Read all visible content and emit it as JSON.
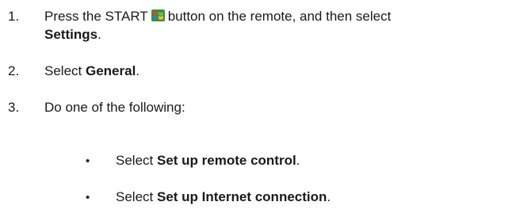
{
  "steps": [
    {
      "number": "1.",
      "text_before_icon": "Press the START",
      "icon": "windows-start-icon",
      "text_after_icon": "button on the remote, and then select",
      "bold_term": "Settings",
      "trailing": "."
    },
    {
      "number": "2.",
      "text_before": "Select",
      "bold_term": "General",
      "trailing": "."
    },
    {
      "number": "3.",
      "text": "Do one of the following:"
    }
  ],
  "options": [
    {
      "bullet": "•",
      "text_before": "Select",
      "bold_term": "Set up remote control",
      "trailing": "."
    },
    {
      "bullet": "•",
      "text_before": "Select",
      "bold_term": "Set up Internet connection",
      "trailing": "."
    }
  ],
  "colors": {
    "text": "#1a1a1a",
    "start_icon_green": "#3fa535",
    "start_icon_red": "#e0462b",
    "start_icon_blue": "#2b7fd6",
    "start_icon_yellow": "#f4c316"
  }
}
